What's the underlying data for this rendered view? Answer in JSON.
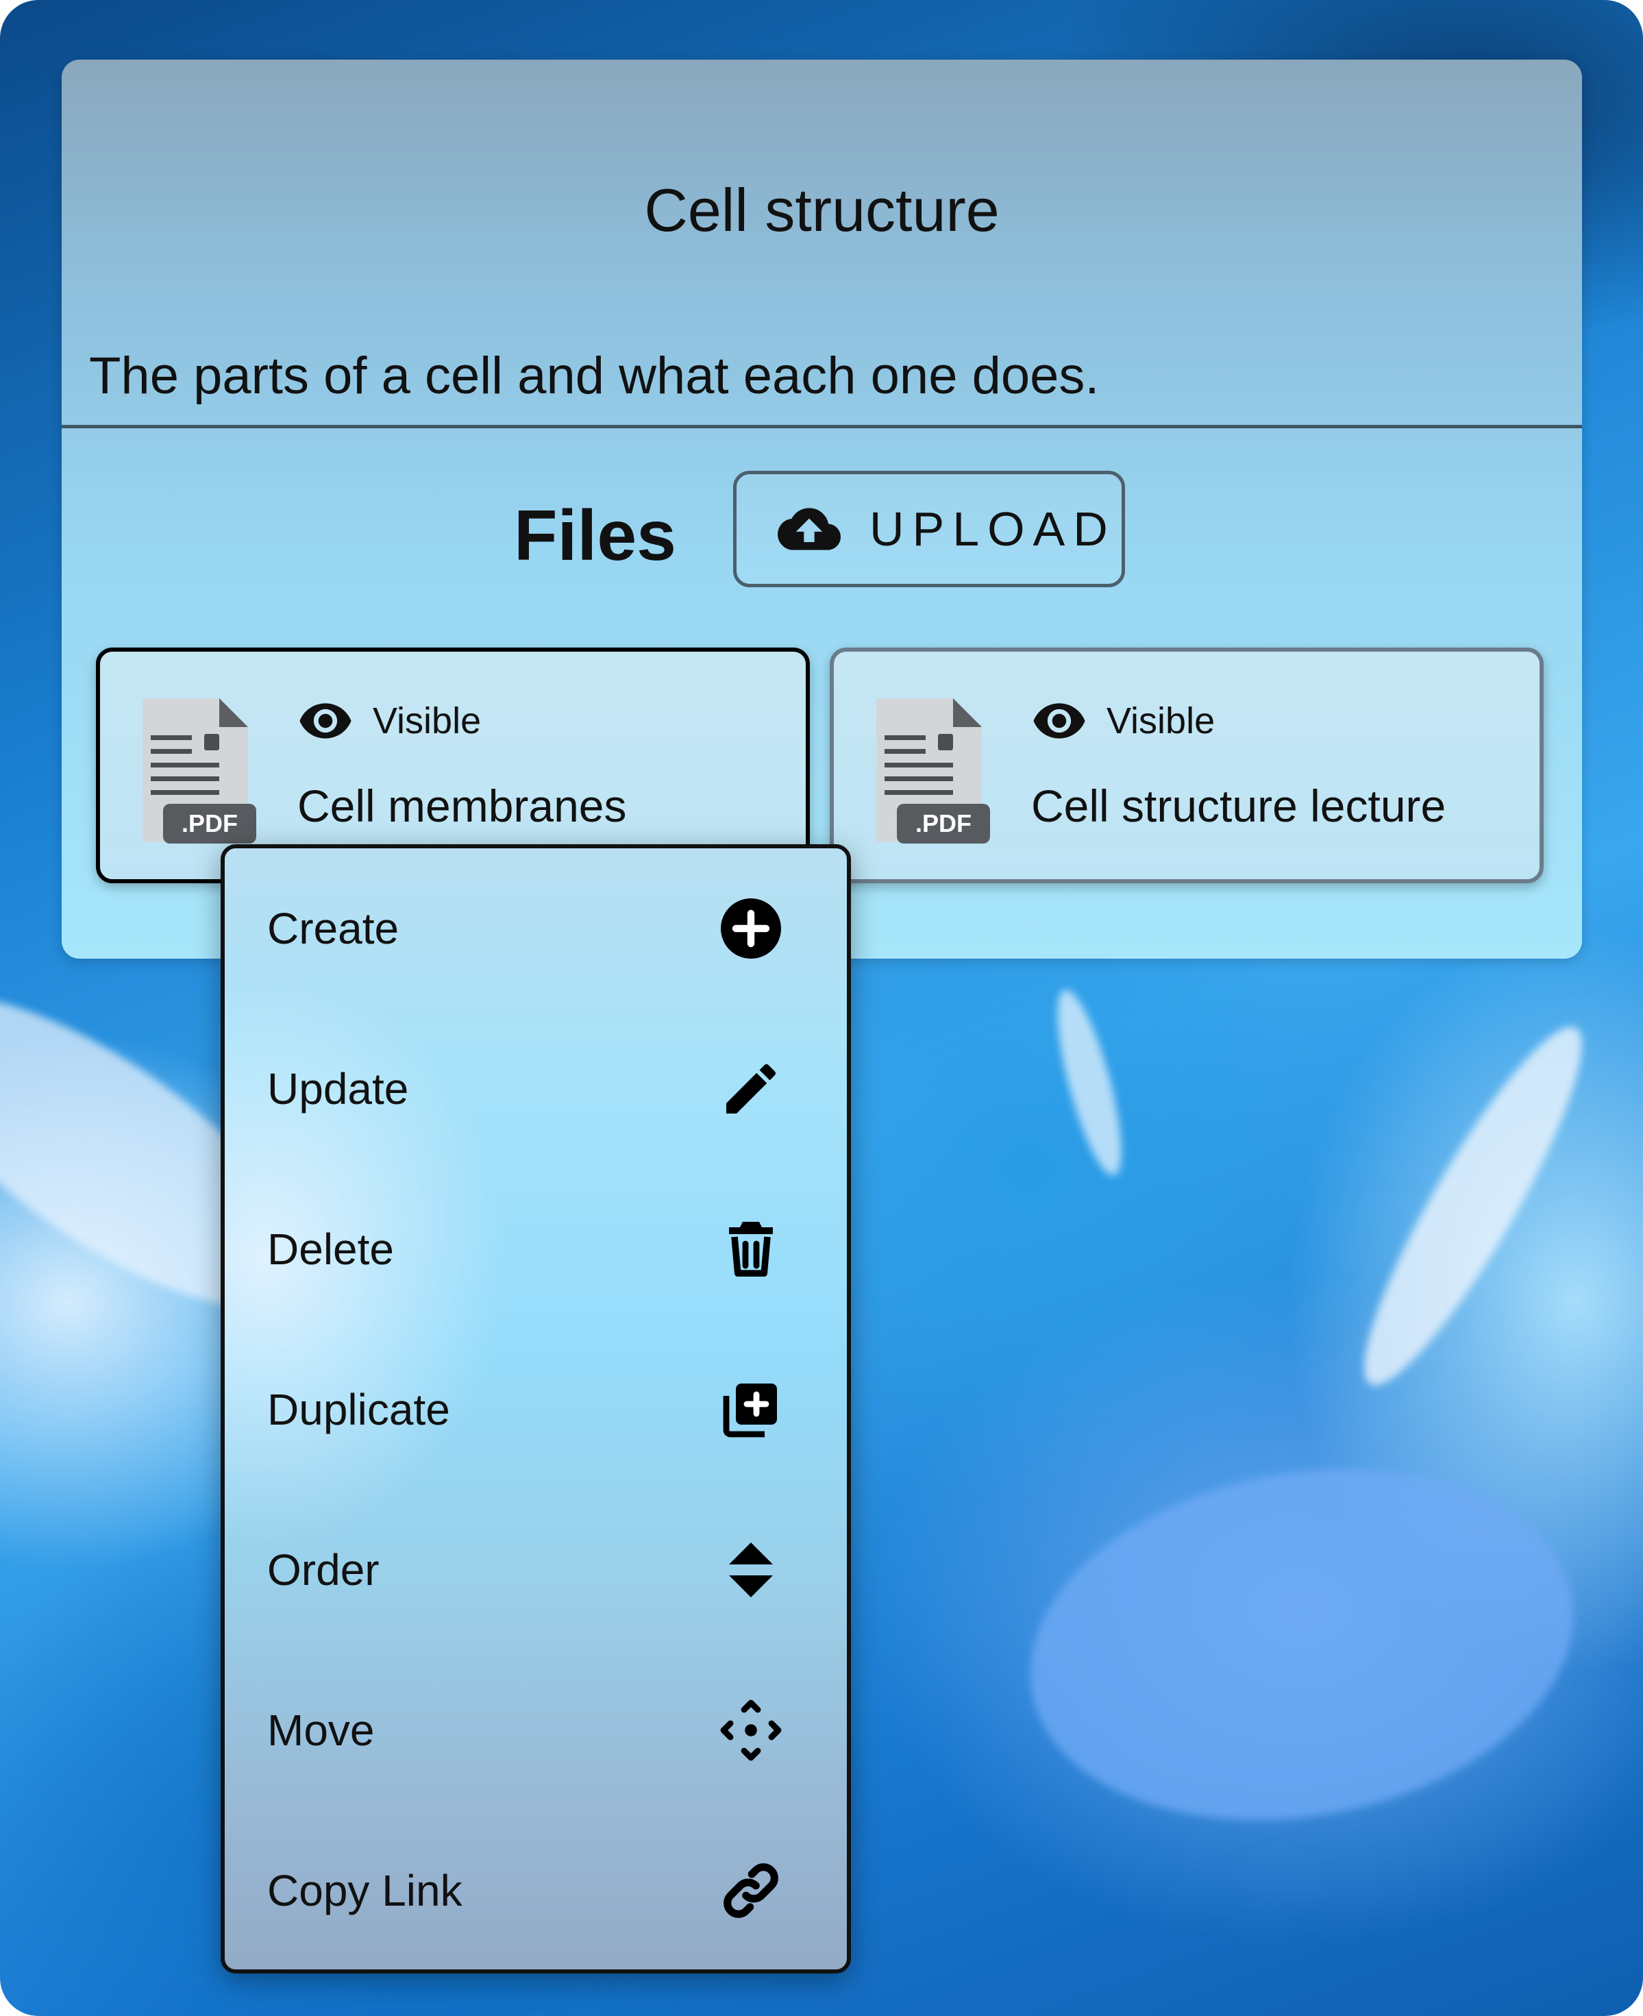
{
  "course": {
    "title": "Cell structure",
    "description": "The parts of a cell and what each one does."
  },
  "files_section": {
    "heading": "Files",
    "upload_label": "UPLOAD",
    "upload_icon": "cloud-upload-icon"
  },
  "files": [
    {
      "badge": ".PDF",
      "visibility": "Visible",
      "name": "Cell membranes",
      "icon": "pdf-file-icon",
      "selected": true
    },
    {
      "badge": ".PDF",
      "visibility": "Visible",
      "name": "Cell structure lecture",
      "icon": "pdf-file-icon",
      "selected": false
    }
  ],
  "context_menu": {
    "items": [
      {
        "label": "Create",
        "icon": "add-circle-icon"
      },
      {
        "label": "Update",
        "icon": "pencil-icon"
      },
      {
        "label": "Delete",
        "icon": "trash-icon"
      },
      {
        "label": "Duplicate",
        "icon": "duplicate-icon"
      },
      {
        "label": "Order",
        "icon": "sort-arrows-icon"
      },
      {
        "label": "Move",
        "icon": "move-icon"
      },
      {
        "label": "Copy Link",
        "icon": "link-icon"
      }
    ]
  }
}
